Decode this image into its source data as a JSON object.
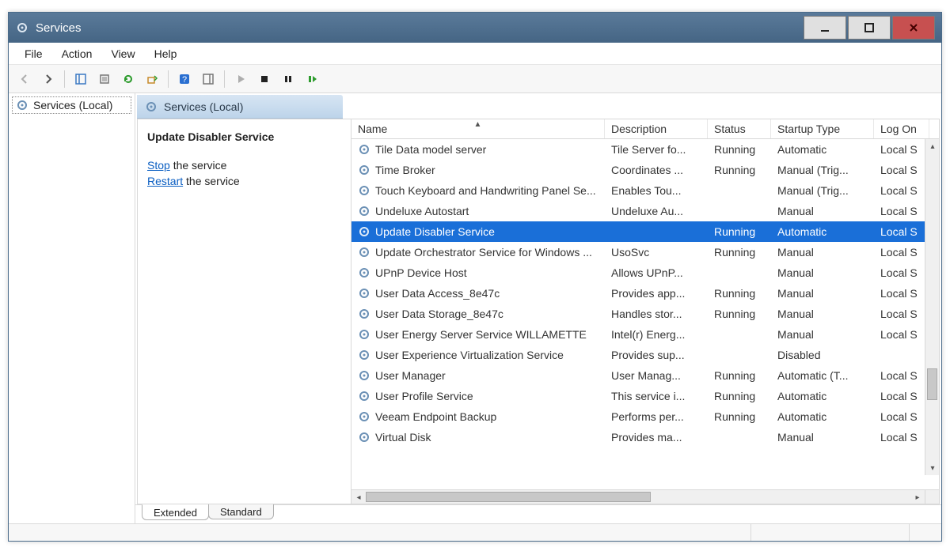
{
  "window": {
    "title": "Services"
  },
  "menubar": {
    "items": [
      "File",
      "Action",
      "View",
      "Help"
    ]
  },
  "nav": {
    "root_label": "Services (Local)"
  },
  "content": {
    "header_label": "Services (Local)"
  },
  "detail": {
    "selected_service_title": "Update Disabler Service",
    "stop_link": "Stop",
    "stop_suffix": " the service",
    "restart_link": "Restart",
    "restart_suffix": " the service"
  },
  "columns": {
    "name": "Name",
    "description": "Description",
    "status": "Status",
    "startup": "Startup Type",
    "logon": "Log On"
  },
  "tabs": {
    "extended": "Extended",
    "standard": "Standard"
  },
  "services": [
    {
      "name": "Tile Data model server",
      "description": "Tile Server fo...",
      "status": "Running",
      "startup": "Automatic",
      "logon": "Local S",
      "selected": false
    },
    {
      "name": "Time Broker",
      "description": "Coordinates ...",
      "status": "Running",
      "startup": "Manual (Trig...",
      "logon": "Local S",
      "selected": false
    },
    {
      "name": "Touch Keyboard and Handwriting Panel Se...",
      "description": "Enables Tou...",
      "status": "",
      "startup": "Manual (Trig...",
      "logon": "Local S",
      "selected": false
    },
    {
      "name": "Undeluxe Autostart",
      "description": "Undeluxe Au...",
      "status": "",
      "startup": "Manual",
      "logon": "Local S",
      "selected": false
    },
    {
      "name": "Update Disabler Service",
      "description": "",
      "status": "Running",
      "startup": "Automatic",
      "logon": "Local S",
      "selected": true
    },
    {
      "name": "Update Orchestrator Service for Windows ...",
      "description": "UsoSvc",
      "status": "Running",
      "startup": "Manual",
      "logon": "Local S",
      "selected": false
    },
    {
      "name": "UPnP Device Host",
      "description": "Allows UPnP...",
      "status": "",
      "startup": "Manual",
      "logon": "Local S",
      "selected": false
    },
    {
      "name": "User Data Access_8e47c",
      "description": "Provides app...",
      "status": "Running",
      "startup": "Manual",
      "logon": "Local S",
      "selected": false
    },
    {
      "name": "User Data Storage_8e47c",
      "description": "Handles stor...",
      "status": "Running",
      "startup": "Manual",
      "logon": "Local S",
      "selected": false
    },
    {
      "name": "User Energy Server Service WILLAMETTE",
      "description": "Intel(r) Energ...",
      "status": "",
      "startup": "Manual",
      "logon": "Local S",
      "selected": false
    },
    {
      "name": "User Experience Virtualization Service",
      "description": "Provides sup...",
      "status": "",
      "startup": "Disabled",
      "logon": "",
      "selected": false
    },
    {
      "name": "User Manager",
      "description": "User Manag...",
      "status": "Running",
      "startup": "Automatic (T...",
      "logon": "Local S",
      "selected": false
    },
    {
      "name": "User Profile Service",
      "description": "This service i...",
      "status": "Running",
      "startup": "Automatic",
      "logon": "Local S",
      "selected": false
    },
    {
      "name": "Veeam Endpoint Backup",
      "description": "Performs per...",
      "status": "Running",
      "startup": "Automatic",
      "logon": "Local S",
      "selected": false
    },
    {
      "name": "Virtual Disk",
      "description": "Provides ma...",
      "status": "",
      "startup": "Manual",
      "logon": "Local S",
      "selected": false
    }
  ]
}
